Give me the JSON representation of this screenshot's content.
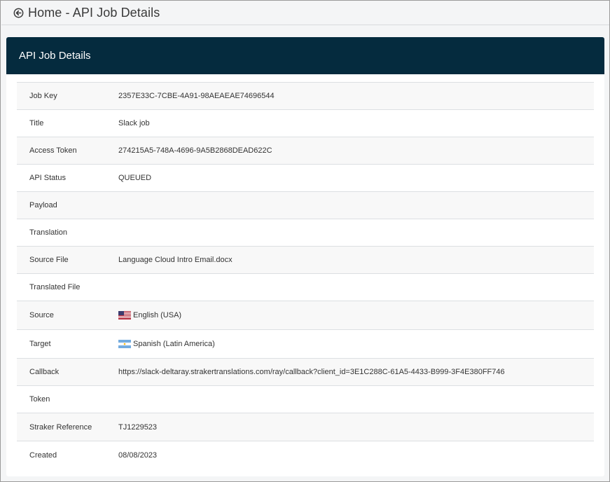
{
  "header": {
    "back_icon": "circle-arrow-left-icon",
    "home_label": "Home",
    "separator": " - ",
    "page_label": "API Job Details"
  },
  "panel": {
    "title": "API Job Details"
  },
  "details": {
    "job_key": {
      "label": "Job Key",
      "value": "2357E33C-7CBE-4A91-98AEAEAE74696544"
    },
    "title": {
      "label": "Title",
      "value": "Slack job"
    },
    "access_token": {
      "label": "Access Token",
      "value": "274215A5-748A-4696-9A5B2868DEAD622C"
    },
    "api_status": {
      "label": "API Status",
      "value": "QUEUED"
    },
    "payload": {
      "label": "Payload",
      "value": ""
    },
    "translation": {
      "label": "Translation",
      "value": ""
    },
    "source_file": {
      "label": "Source File",
      "value": "Language Cloud Intro Email.docx"
    },
    "translated_file": {
      "label": "Translated File",
      "value": ""
    },
    "source": {
      "label": "Source",
      "value": "English (USA)",
      "flag_icon": "us-flag-icon"
    },
    "target": {
      "label": "Target",
      "value": "Spanish (Latin America)",
      "flag_icon": "argentina-flag-icon"
    },
    "callback": {
      "label": "Callback",
      "value": "https://slack-deltaray.strakertranslations.com/ray/callback?client_id=3E1C288C-61A5-4433-B999-3F4E380FF746"
    },
    "token": {
      "label": "Token",
      "value": ""
    },
    "straker_reference": {
      "label": "Straker Reference",
      "value": "TJ1229523"
    },
    "created": {
      "label": "Created",
      "value": "08/08/2023"
    }
  },
  "colors": {
    "header_bg": "#052b3e",
    "row_alt": "#f8f8f8",
    "border": "#dcdfe2"
  }
}
